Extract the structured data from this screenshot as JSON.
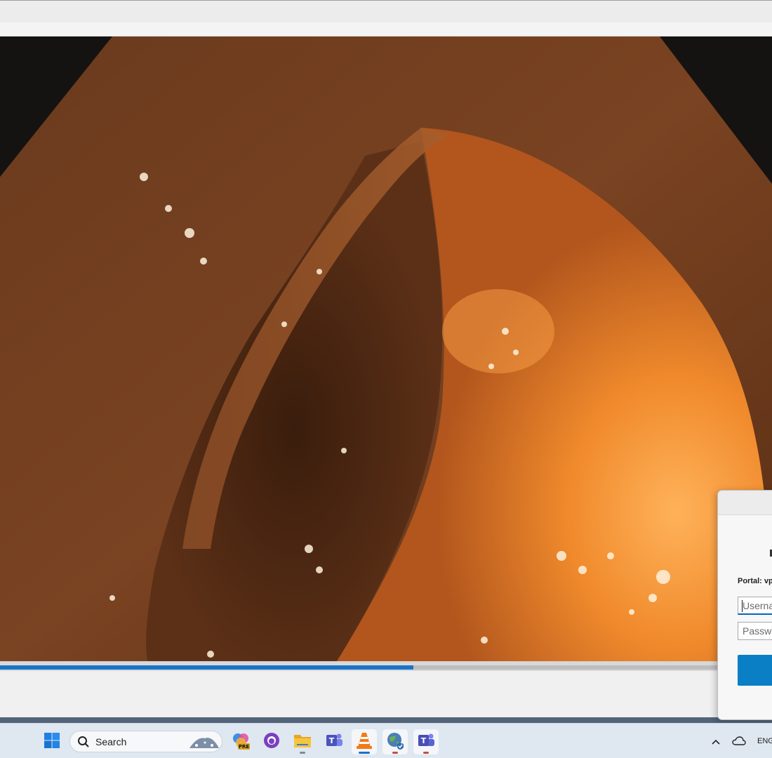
{
  "video": {
    "progress_percent": 53.5
  },
  "login_dialog": {
    "portal_label": "Portal: vp",
    "username_placeholder": "Userna",
    "password_placeholder": "Passwo"
  },
  "taskbar": {
    "search_label": "Search",
    "pinned_apps": [
      "start-icon",
      "copilot-pre-icon",
      "github-desktop-icon",
      "file-explorer-icon",
      "teams-classic-icon",
      "vlc-icon",
      "vpn-globe-icon",
      "teams-icon"
    ],
    "tray_language": "ENG"
  },
  "colors": {
    "accent": "#1a73c9",
    "dialog_button": "#0a7fc5"
  }
}
